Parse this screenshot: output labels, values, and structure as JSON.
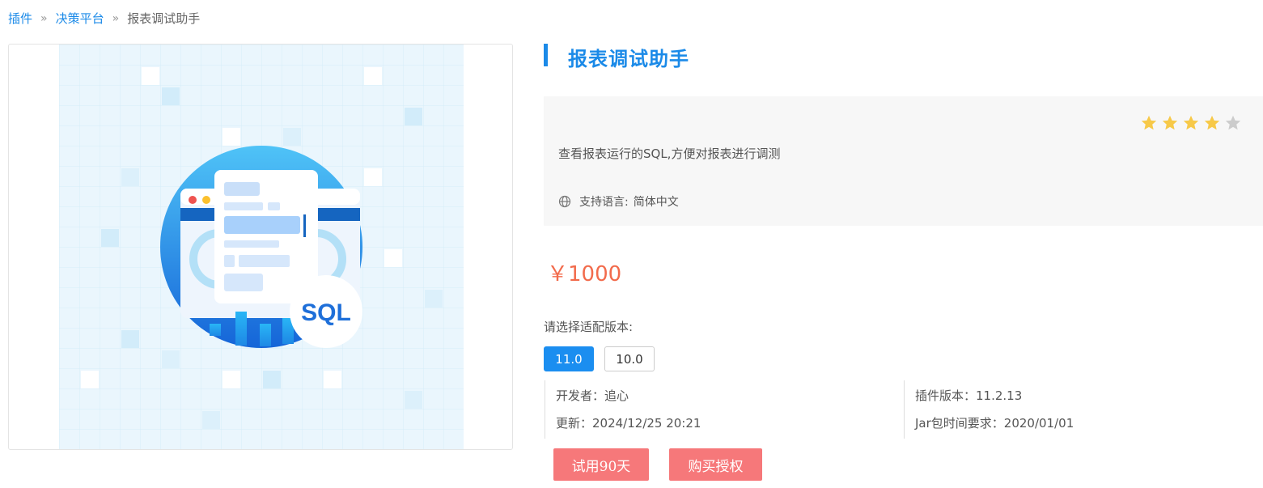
{
  "breadcrumb": {
    "items": [
      "插件",
      "决策平台"
    ],
    "separator": "»",
    "current": "报表调试助手"
  },
  "plugin": {
    "title": "报表调试助手",
    "description": "查看报表运行的SQL,方便对报表进行调测",
    "rating": 4,
    "rating_max": 5,
    "language_label": "支持语言:",
    "language_value": "简体中文",
    "price": "￥1000",
    "image_badge_text": "SQL"
  },
  "version": {
    "label": "请选择适配版本:",
    "options": [
      "11.0",
      "10.0"
    ],
    "selected": "11.0"
  },
  "info": {
    "developer": "开发者：追心",
    "updated": "更新：2024/12/25 20:21",
    "plugin_version": "插件版本：11.2.13",
    "jar_requirement": "Jar包时间要求：2020/01/01"
  },
  "actions": {
    "trial_label": "试用90天",
    "buy_label": "购买授权"
  },
  "colors": {
    "accent": "#1b8ae8",
    "price": "#f26b4c",
    "action": "#f6787a",
    "star_on": "#f7c948",
    "star_off": "#cccccc"
  }
}
